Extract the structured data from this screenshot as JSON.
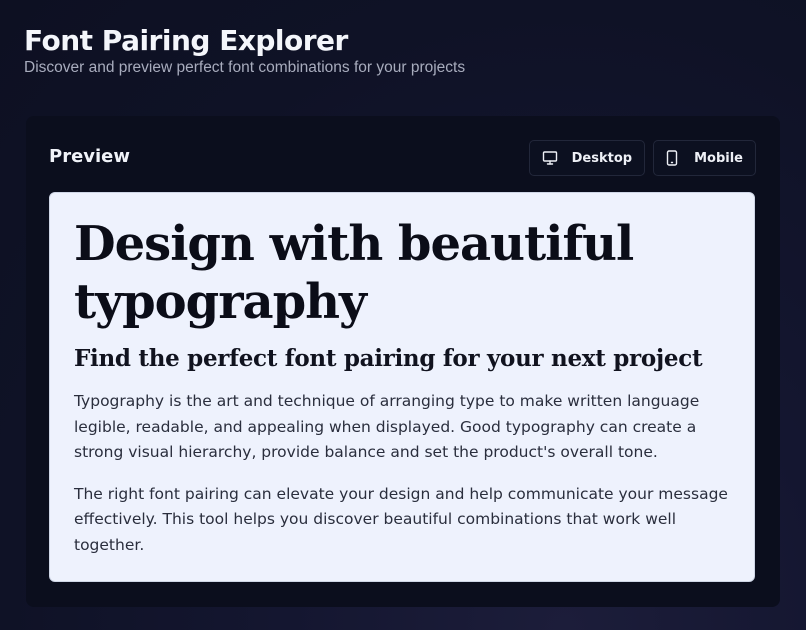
{
  "app": {
    "title": "Font Pairing Explorer",
    "subtitle": "Discover and preview perfect font combinations for your projects"
  },
  "preview": {
    "title": "Preview",
    "devices": [
      {
        "label": "Desktop",
        "icon": "monitor-icon"
      },
      {
        "label": "Mobile",
        "icon": "smartphone-icon"
      }
    ],
    "heading": "Design with beautiful typography",
    "subheading": "Find the perfect font pairing for your next project",
    "paragraphs": [
      "Typography is the art and technique of arranging type to make written language legible, readable, and appealing when displayed. Good typography can create a strong visual hierarchy, provide balance and set the product's overall tone.",
      "The right font pairing can elevate your design and help communicate your message effectively. This tool helps you discover beautiful combinations that work well together."
    ]
  },
  "colors": {
    "background": "#0f1226",
    "panel": "#0b0e1d",
    "canvas": "#eef2fd",
    "text_primary": "#f4f6fb",
    "text_muted": "#a8acbd"
  }
}
